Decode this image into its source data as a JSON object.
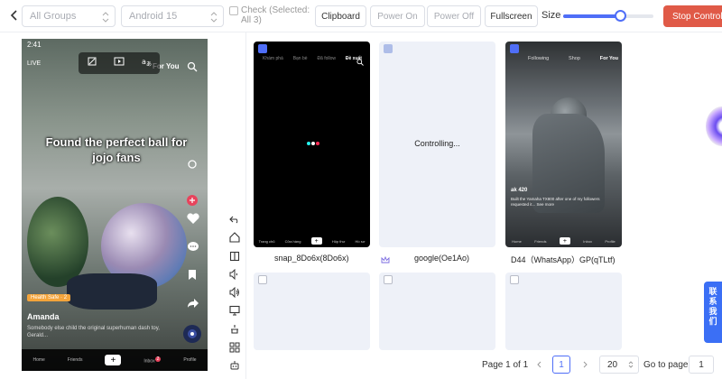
{
  "toolbar": {
    "group_select": "All Groups",
    "android_select": "Android 15",
    "check_label": "Check (Selected: All 3)",
    "clipboard": "Clipboard",
    "power_on": "Power On",
    "power_off": "Power Off",
    "fullscreen": "Fullscreen",
    "size_label": "Size",
    "size_value": 0.63,
    "stop_control": "Stop Control"
  },
  "left_phone": {
    "time": "2:41",
    "live": "LIVE",
    "for_you": "For You",
    "caption": "Found the perfect ball for jojo fans",
    "badge": "Health Safe",
    "badge_count": "2",
    "username": "Amanda",
    "description": "Somebody else child the original superhuman dash toy, Gerald...",
    "nav": [
      "Home",
      "Friends",
      "+",
      "Inbox",
      "Profile"
    ],
    "inbox_count": "2"
  },
  "devices": [
    {
      "label": "snap_8Do6x(8Do6x)",
      "tabs": [
        "Khám phá",
        "Bạn bè",
        "Đã follow",
        "Đề xuất"
      ],
      "nav": [
        "Trang chủ",
        "Cửa hàng",
        "+",
        "Hộp thư",
        "Hồ sơ"
      ]
    },
    {
      "label": "google(Oe1Ao)",
      "status": "Controlling..."
    },
    {
      "label": "D44（WhatsApp）GP(qTLtf)",
      "tabs": [
        "Following",
        "Shop",
        "For You"
      ],
      "user": "ak 420",
      "text": "Built the Yamaha TX800 after one of my followers requested it... See more",
      "nav": [
        "Home",
        "Friends",
        "+",
        "Inbox",
        "Profile"
      ]
    }
  ],
  "pagination": {
    "page_info": "Page 1 of 1",
    "current_page": "1",
    "page_size": "20",
    "goto_label": "Go to page",
    "goto_value": "1"
  },
  "contact_tab": "联系我们",
  "colors": {
    "accent": "#4f6ef7",
    "stop": "#e05a47",
    "contact": "#3b6ff5"
  }
}
